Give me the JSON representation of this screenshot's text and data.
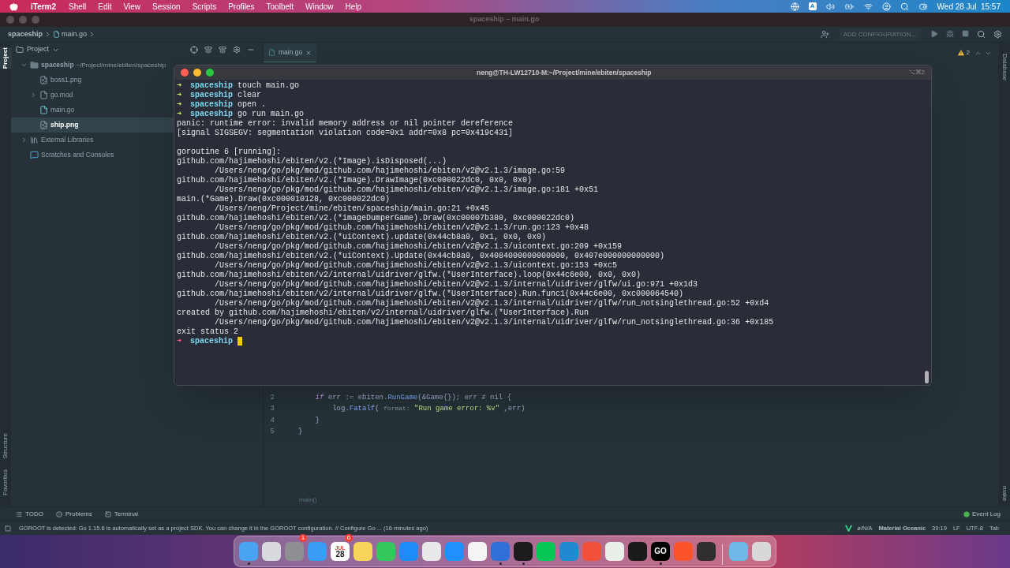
{
  "menubar": {
    "app": "iTerm2",
    "menus": [
      "Shell",
      "Edit",
      "View",
      "Session",
      "Scripts",
      "Profiles",
      "Toolbelt",
      "Window",
      "Help"
    ],
    "input_source": "A",
    "clock": "Wed 28 Jul  15:57"
  },
  "ide": {
    "title": "spaceship – main.go",
    "breadcrumb": [
      "spaceship",
      "main.go"
    ],
    "add_configuration": "ADD CONFIGURATION...",
    "side_left_top": {
      "label": "Project",
      "selected": true
    },
    "side_left_bottom": [
      "Structure",
      "Favorites"
    ],
    "side_right": [
      "Database",
      "make"
    ],
    "panel_title": "Project",
    "tree": [
      {
        "name": "spaceship",
        "path": "~/Project/mine/ebiten/spaceship",
        "kind": "folder",
        "expanded": true,
        "selected": false,
        "children": [
          {
            "name": "boss1.png",
            "kind": "image",
            "selected": false
          },
          {
            "name": "go.mod",
            "kind": "mod",
            "expanded": false,
            "selected": false
          },
          {
            "name": "main.go",
            "kind": "go",
            "selected": false
          },
          {
            "name": "ship.png",
            "kind": "image",
            "selected": true
          }
        ]
      },
      {
        "name": "External Libraries",
        "kind": "library",
        "expanded": false,
        "selected": false
      },
      {
        "name": "Scratches and Consoles",
        "kind": "scratch",
        "selected": false
      }
    ],
    "editor_tab": "main.go",
    "warnings": "2",
    "code": [
      {
        "number": "2",
        "tokens": [
          {
            "kind": "keyword",
            "text": "    if"
          },
          {
            "kind": "plain",
            "text": " err := ebiten."
          },
          {
            "kind": "func",
            "text": "RunGame"
          },
          {
            "kind": "plain",
            "text": "(&Game{}); err ≠ nil {"
          }
        ]
      },
      {
        "number": "3",
        "tokens": [
          {
            "kind": "plain",
            "text": "        log."
          },
          {
            "kind": "func",
            "text": "Fatalf"
          },
          {
            "kind": "plain",
            "text": "( "
          },
          {
            "kind": "hint",
            "text": "format:"
          },
          {
            "kind": "string",
            "text": " \"Run game error: %v\""
          },
          {
            "kind": "plain",
            "text": " ,err)"
          }
        ]
      },
      {
        "number": "4",
        "tokens": [
          {
            "kind": "plain",
            "text": "    }"
          }
        ]
      },
      {
        "number": "5",
        "tokens": [
          {
            "kind": "plain",
            "text": "}"
          }
        ]
      }
    ],
    "code_footer": "main()",
    "bottom_tabs": [
      {
        "kind": "todo",
        "label": "TODO"
      },
      {
        "kind": "problems",
        "label": "Problems"
      },
      {
        "kind": "terminal",
        "label": "Terminal"
      }
    ],
    "event_log": "Event Log",
    "status_message": "GOROOT is detected: Go 1.15.6 is automatically set as a project SDK. You can change it in the GOROOT configuration. // Configure Go ... (16 minutes ago)",
    "status_items": [
      "ø/N/A",
      "Material Oceanic",
      "39:19",
      "LF",
      "UTF-8",
      "Tab"
    ]
  },
  "terminal": {
    "title": "neng@TH-LW12710-M:~/Project/mine/ebiten/spaceship",
    "shortcut": "⌥⌘2",
    "lines": [
      {
        "kind": "prompt",
        "symbol": "➜",
        "error": false,
        "dir": "spaceship",
        "command": "touch main.go",
        "cursor": false
      },
      {
        "kind": "prompt",
        "symbol": "➜",
        "error": false,
        "dir": "spaceship",
        "command": "clear",
        "cursor": false
      },
      {
        "kind": "prompt",
        "symbol": "➜",
        "error": false,
        "dir": "spaceship",
        "command": "open .",
        "cursor": false
      },
      {
        "kind": "prompt",
        "symbol": "➜",
        "error": false,
        "dir": "spaceship",
        "command": "go run main.go",
        "cursor": false
      },
      {
        "kind": "output",
        "text": "panic: runtime error: invalid memory address or nil pointer dereference"
      },
      {
        "kind": "output",
        "text": "[signal SIGSEGV: segmentation violation code=0x1 addr=0x8 pc=0x419c431]"
      },
      {
        "kind": "blank"
      },
      {
        "kind": "output",
        "text": "goroutine 6 [running]:"
      },
      {
        "kind": "output",
        "text": "github.com/hajimehoshi/ebiten/v2.(*Image).isDisposed(...)"
      },
      {
        "kind": "output",
        "text": "\t/Users/neng/go/pkg/mod/github.com/hajimehoshi/ebiten/v2@v2.1.3/image.go:59"
      },
      {
        "kind": "output",
        "text": "github.com/hajimehoshi/ebiten/v2.(*Image).DrawImage(0xc000022dc0, 0x0, 0x0)"
      },
      {
        "kind": "output",
        "text": "\t/Users/neng/go/pkg/mod/github.com/hajimehoshi/ebiten/v2@v2.1.3/image.go:181 +0x51"
      },
      {
        "kind": "output",
        "text": "main.(*Game).Draw(0xc000010128, 0xc000022dc0)"
      },
      {
        "kind": "output",
        "text": "\t/Users/neng/Project/mine/ebiten/spaceship/main.go:21 +0x45"
      },
      {
        "kind": "output",
        "text": "github.com/hajimehoshi/ebiten/v2.(*imageDumperGame).Draw(0xc00007b380, 0xc000022dc0)"
      },
      {
        "kind": "output",
        "text": "\t/Users/neng/go/pkg/mod/github.com/hajimehoshi/ebiten/v2@v2.1.3/run.go:123 +0x48"
      },
      {
        "kind": "output",
        "text": "github.com/hajimehoshi/ebiten/v2.(*uiContext).update(0x44cb8a0, 0x1, 0x0, 0x0)"
      },
      {
        "kind": "output",
        "text": "\t/Users/neng/go/pkg/mod/github.com/hajimehoshi/ebiten/v2@v2.1.3/uicontext.go:209 +0x159"
      },
      {
        "kind": "output",
        "text": "github.com/hajimehoshi/ebiten/v2.(*uiContext).Update(0x44cb8a0, 0x4084000000000000, 0x407e000000000000)"
      },
      {
        "kind": "output",
        "text": "\t/Users/neng/go/pkg/mod/github.com/hajimehoshi/ebiten/v2@v2.1.3/uicontext.go:153 +0xc5"
      },
      {
        "kind": "output",
        "text": "github.com/hajimehoshi/ebiten/v2/internal/uidriver/glfw.(*UserInterface).loop(0x44c6e00, 0x0, 0x0)"
      },
      {
        "kind": "output",
        "text": "\t/Users/neng/go/pkg/mod/github.com/hajimehoshi/ebiten/v2@v2.1.3/internal/uidriver/glfw/ui.go:971 +0x1d3"
      },
      {
        "kind": "output",
        "text": "github.com/hajimehoshi/ebiten/v2/internal/uidriver/glfw.(*UserInterface).Run.func1(0x44c6e00, 0xc000064540)"
      },
      {
        "kind": "output",
        "text": "\t/Users/neng/go/pkg/mod/github.com/hajimehoshi/ebiten/v2@v2.1.3/internal/uidriver/glfw/run_notsinglethread.go:52 +0xd4"
      },
      {
        "kind": "output",
        "text": "created by github.com/hajimehoshi/ebiten/v2/internal/uidriver/glfw.(*UserInterface).Run"
      },
      {
        "kind": "output",
        "text": "\t/Users/neng/go/pkg/mod/github.com/hajimehoshi/ebiten/v2@v2.1.3/internal/uidriver/glfw/run_notsinglethread.go:36 +0x185"
      },
      {
        "kind": "output",
        "text": "exit status 2"
      },
      {
        "kind": "prompt",
        "symbol": "➜",
        "error": true,
        "dir": "spaceship",
        "cursor": true
      }
    ]
  },
  "dock": [
    {
      "color": "#4aa3f0",
      "running": true
    },
    {
      "color": "#d9d9e0",
      "running": false
    },
    {
      "color": "#8e8e93",
      "running": false,
      "badge": "1"
    },
    {
      "color": "#3b9cf5",
      "running": false
    },
    {
      "color": "#ffffff",
      "running": false,
      "month": "JUL",
      "label": "28",
      "badge": "6"
    },
    {
      "color": "#f7d55b",
      "running": false
    },
    {
      "color": "#34c759",
      "running": false
    },
    {
      "color": "#1d8cf8",
      "running": false
    },
    {
      "color": "#e8e8e8",
      "running": false
    },
    {
      "color": "#1e90ff",
      "running": false
    },
    {
      "color": "#f4f4f4",
      "running": false
    },
    {
      "color": "#2f6fd6",
      "running": true
    },
    {
      "color": "#1c1c1c",
      "running": true
    },
    {
      "color": "#06c755",
      "running": false
    },
    {
      "color": "#1f8ad2",
      "running": false
    },
    {
      "color": "#f05138",
      "running": false
    },
    {
      "color": "#e9efe9",
      "running": false
    },
    {
      "color": "#1a1a1a",
      "running": false
    },
    {
      "color": "#000000",
      "running": true,
      "label": "GO"
    },
    {
      "color": "#fb542b",
      "running": false
    },
    {
      "color": "#302e31",
      "running": false
    },
    {
      "color": "#6fb8e8",
      "running": false,
      "separator": true
    },
    {
      "color": "#d8d8d8",
      "running": false
    }
  ]
}
